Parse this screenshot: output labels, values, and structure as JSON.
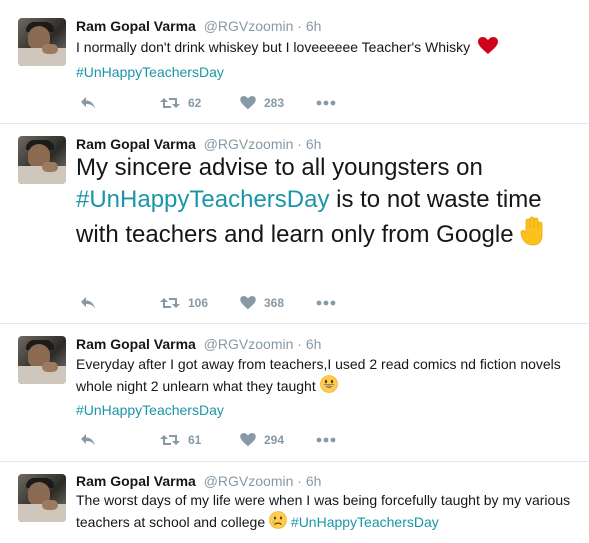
{
  "tweets": [
    {
      "name": "Ram Gopal Varma",
      "handle": "@RGVzoomin",
      "time": "6h",
      "text": "I normally don't drink whiskey but I loveeeeee Teacher's Whisky",
      "hashtag": "#UnHappyTeachersDay",
      "retweets": "62",
      "likes": "283",
      "emoji": "red-heart"
    },
    {
      "name": "Ram Gopal Varma",
      "handle": "@RGVzoomin",
      "time": "6h",
      "text_before": "My sincere advise to all youngsters on",
      "hashtag": "#UnHappyTeachersDay",
      "text_after": "is to not waste time with teachers and learn only from Google",
      "retweets": "106",
      "likes": "368",
      "emoji": "raised-hand"
    },
    {
      "name": "Ram Gopal Varma",
      "handle": "@RGVzoomin",
      "time": "6h",
      "text": "Everyday after I got away from teachers,I used 2 read comics nd fiction novels whole night 2 unlearn what they taught",
      "hashtag": "#UnHappyTeachersDay",
      "retweets": "61",
      "likes": "294",
      "emoji": "grinning-face"
    },
    {
      "name": "Ram Gopal Varma",
      "handle": "@RGVzoomin",
      "time": "6h",
      "text": "The worst days of my life were when I was being forcefully taught by my various teachers at school and college",
      "hashtag": "#UnHappyTeachersDay",
      "emoji": "crying-face"
    }
  ],
  "colors": {
    "hashtag": "#1b95a8",
    "meta": "#8899a6",
    "divider": "#e1e8ed",
    "heart": "#e0245e"
  },
  "icons": [
    "reply-icon",
    "retweet-icon",
    "like-icon",
    "more-icon"
  ]
}
